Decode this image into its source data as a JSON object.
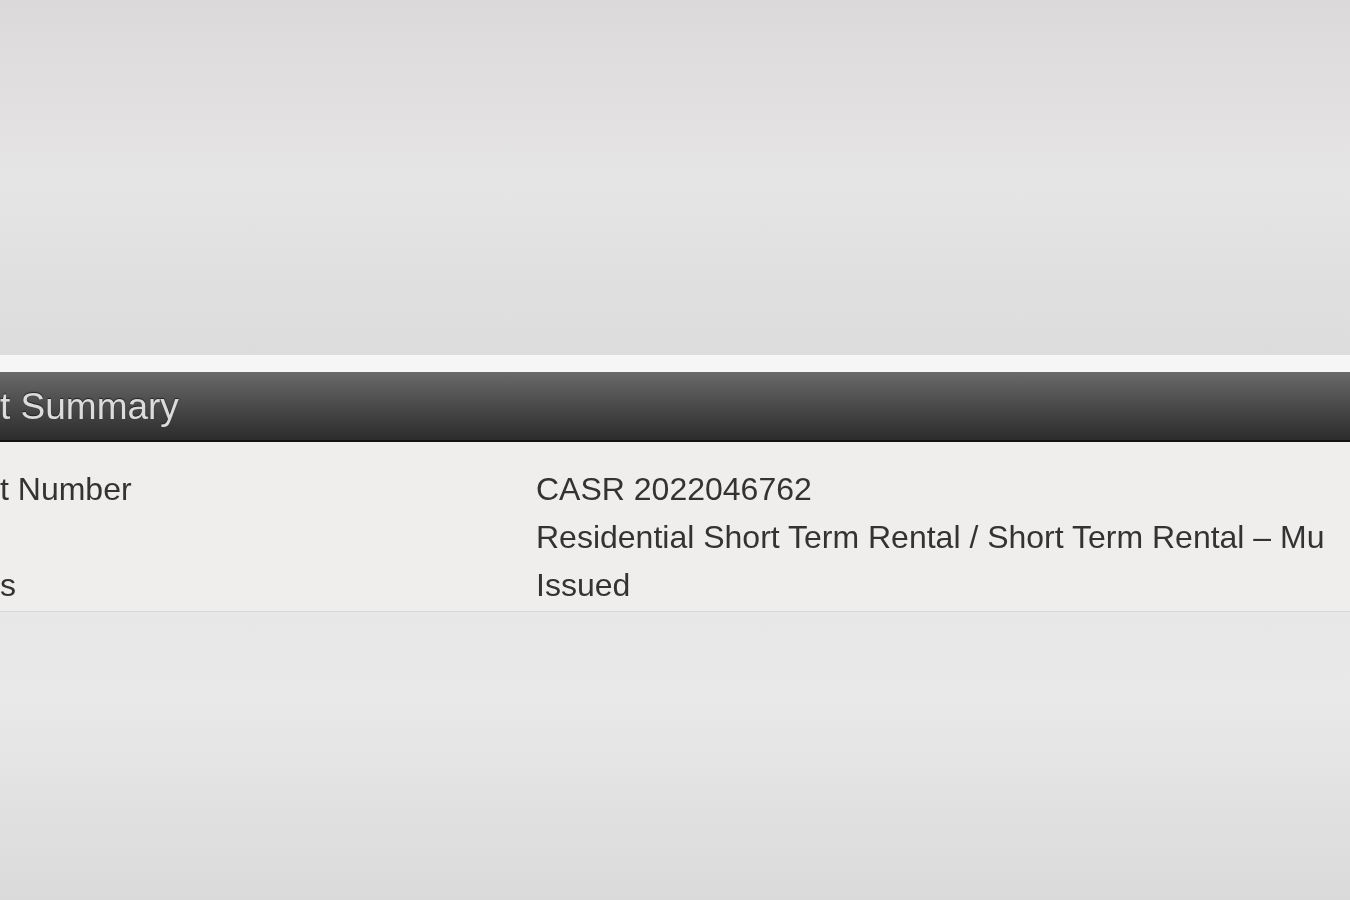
{
  "section": {
    "title": "t Summary",
    "rows": [
      {
        "label": "t Number",
        "value": "CASR 2022046762"
      },
      {
        "value": "Residential Short Term Rental / Short Term Rental – Mu"
      },
      {
        "label": "s",
        "value": "Issued"
      }
    ]
  }
}
